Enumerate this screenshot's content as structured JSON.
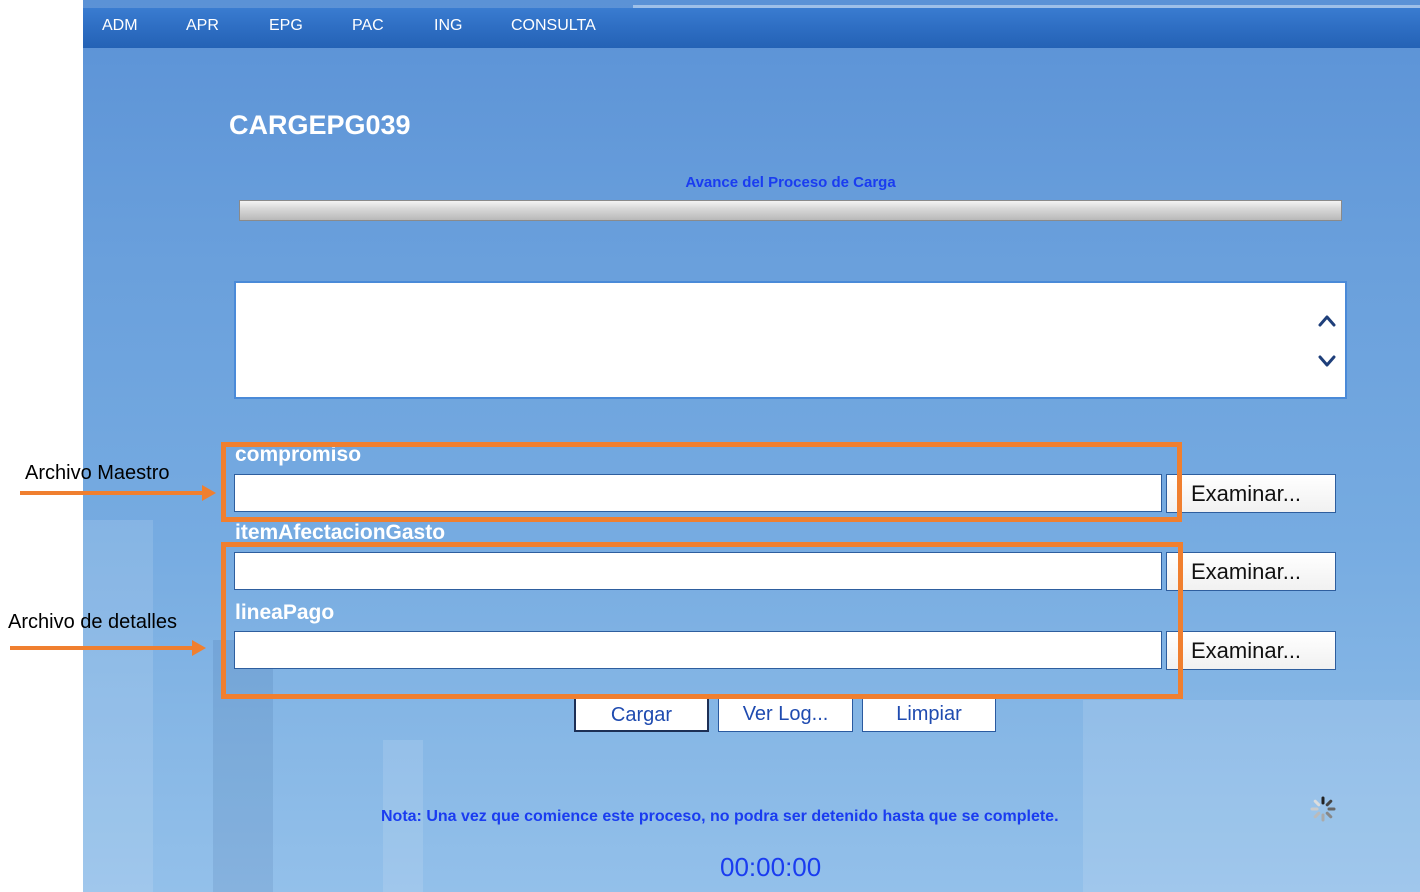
{
  "menu": {
    "items": [
      "ADM",
      "APR",
      "EPG",
      "PAC",
      "ING",
      "CONSULTA"
    ]
  },
  "page": {
    "title": "CARGEPG039",
    "progress_label": "Avance del Proceso de Carga",
    "progress_value": 0
  },
  "files": {
    "compromiso": {
      "label": "compromiso",
      "value": "",
      "browse": "Examinar..."
    },
    "itemAfectacionGasto": {
      "label": "itemAfectacionGasto",
      "value": "",
      "browse": "Examinar..."
    },
    "lineaPago": {
      "label": "lineaPago",
      "value": "",
      "browse": "Examinar..."
    }
  },
  "actions": {
    "cargar": "Cargar",
    "ver_log": "Ver Log...",
    "limpiar": "Limpiar"
  },
  "note": "Nota: Una vez que comience este proceso, no podra ser detenido hasta que se complete.",
  "timer": "00:00:00",
  "annotations": {
    "maestro": "Archivo Maestro",
    "detalles": "Archivo de detalles"
  },
  "colors": {
    "menubar": "#2f6fc4",
    "accent_text": "#1a3cf0",
    "highlight": "#f07f2f"
  }
}
